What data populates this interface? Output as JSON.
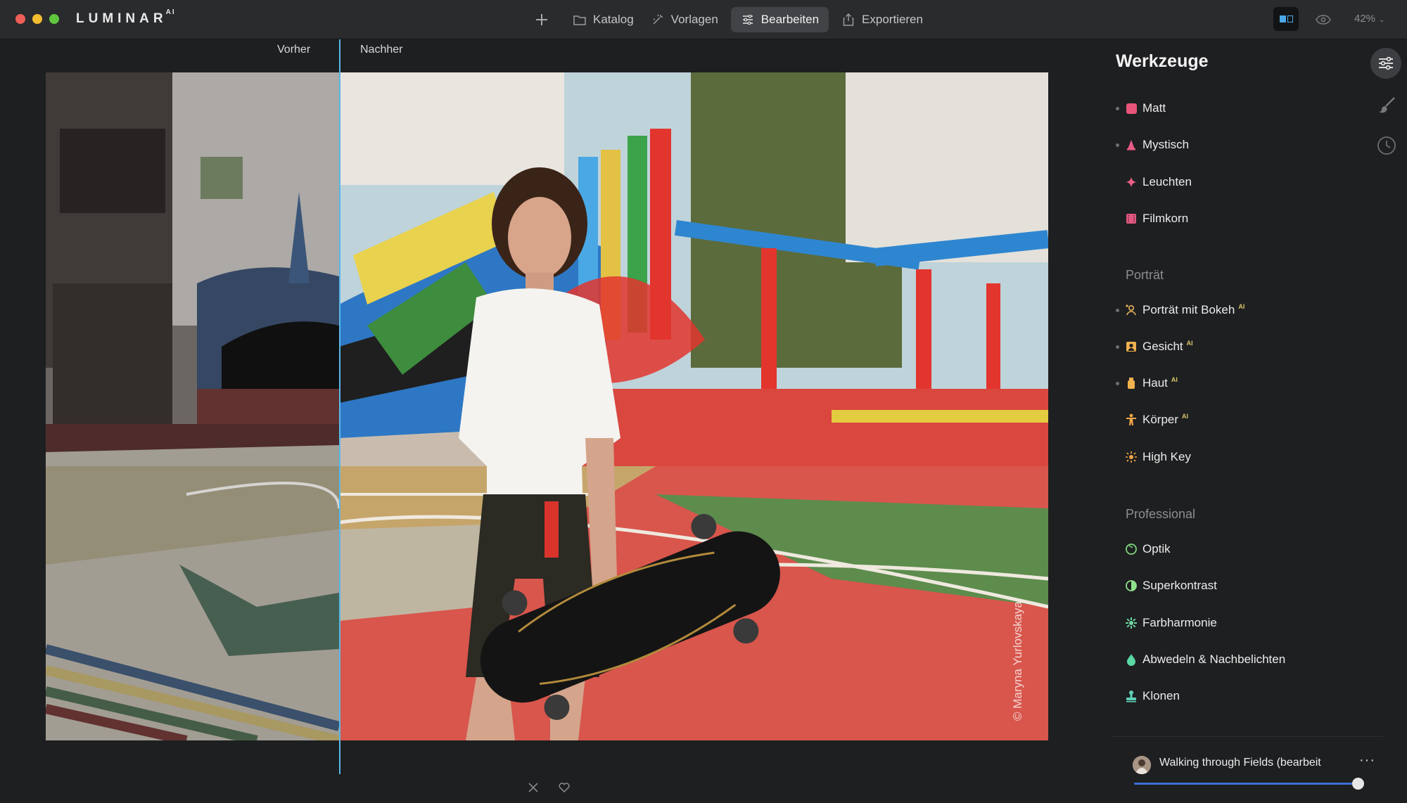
{
  "app": {
    "brand": "LUMINAR",
    "brand_suffix": "AI"
  },
  "topnav": {
    "add_icon": "plus-icon",
    "items": [
      {
        "label": "Katalog",
        "icon": "folder-icon"
      },
      {
        "label": "Vorlagen",
        "icon": "sparkle-icon"
      },
      {
        "label": "Bearbeiten",
        "icon": "sliders-icon",
        "active": true
      },
      {
        "label": "Exportieren",
        "icon": "share-icon"
      }
    ]
  },
  "toolbar_right": {
    "compare_icon": "compare-view-icon",
    "preview_icon": "eye-icon",
    "zoom": "42%"
  },
  "canvas": {
    "before_label": "Vorher",
    "after_label": "Nachher",
    "watermark": "© Maryna Yurlovskaya",
    "split_fraction": 0.293
  },
  "bottom_actions": {
    "reject_icon": "close-icon",
    "favorite_icon": "heart-icon"
  },
  "panel": {
    "title": "Werkzeuge",
    "side_icons": [
      "sliders-icon",
      "brush-icon",
      "history-clock-icon"
    ],
    "creative_tools": [
      {
        "label": "Matt",
        "icon": "matte-icon",
        "color": "#e8557a",
        "dot": true
      },
      {
        "label": "Mystisch",
        "icon": "mystic-icon",
        "color": "#ea5c86",
        "dot": true
      },
      {
        "label": "Leuchten",
        "icon": "glow-icon",
        "color": "#ef5f86",
        "dot": false
      },
      {
        "label": "Filmkorn",
        "icon": "film-grain-icon",
        "color": "#e3577f",
        "dot": false
      }
    ],
    "portrait_section": "Porträt",
    "portrait_tools": [
      {
        "label": "Porträt mit Bokeh",
        "ai": "AI",
        "icon": "portrait-bokeh-icon",
        "color": "#e9b25a",
        "dot": true
      },
      {
        "label": "Gesicht",
        "ai": "AI",
        "icon": "face-icon",
        "color": "#efb04f",
        "dot": true
      },
      {
        "label": "Haut",
        "ai": "AI",
        "icon": "skin-icon",
        "color": "#f0b24e",
        "dot": true
      },
      {
        "label": "Körper",
        "ai": "AI",
        "icon": "body-icon",
        "color": "#f2a846",
        "dot": false
      },
      {
        "label": "High Key",
        "ai": "",
        "icon": "high-key-icon",
        "color": "#f2a846",
        "dot": false
      }
    ],
    "professional_section": "Professional",
    "professional_tools": [
      {
        "label": "Optik",
        "icon": "optics-icon",
        "color": "#7ed67a",
        "dot": false
      },
      {
        "label": "Superkontrast",
        "icon": "supercontrast-icon",
        "color": "#8fe08a",
        "dot": false
      },
      {
        "label": "Farbharmonie",
        "icon": "color-harmony-icon",
        "color": "#70d6a2",
        "dot": false
      },
      {
        "label": "Abwedeln & Nachbelichten",
        "icon": "dodge-burn-icon",
        "color": "#5ad7a4",
        "dot": false
      },
      {
        "label": "Klonen",
        "icon": "clone-stamp-icon",
        "color": "#5fd0b6",
        "dot": false
      }
    ],
    "preset": {
      "name": "Walking through Fields (bearbeit",
      "more": "···",
      "amount": 1.0
    }
  }
}
